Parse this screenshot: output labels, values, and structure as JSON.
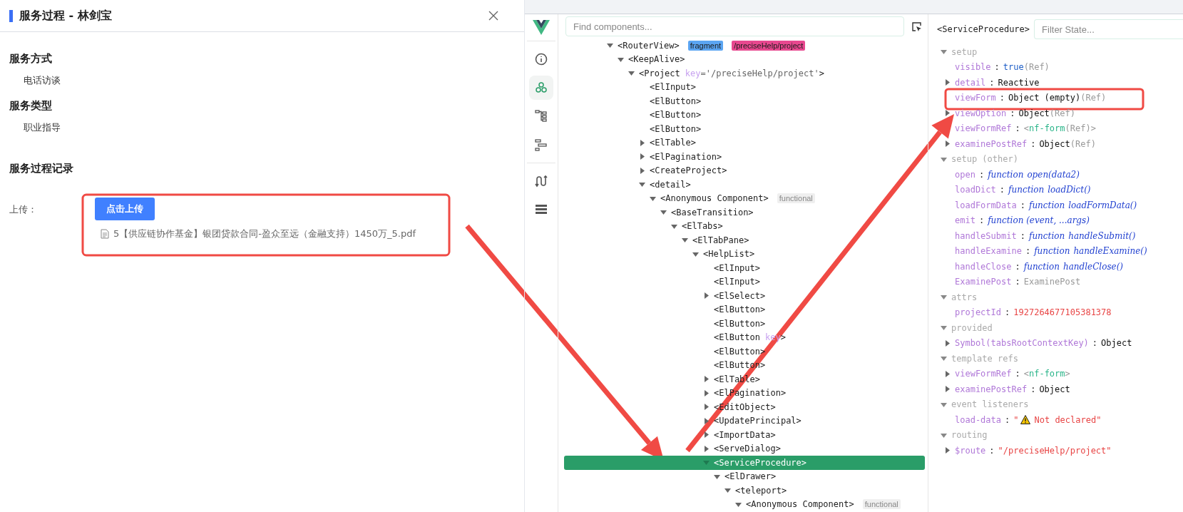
{
  "drawer": {
    "title": "服务过程 - 林剑宝",
    "sections": [
      {
        "heading": "服务方式",
        "value": "电话访谈"
      },
      {
        "heading": "服务类型",
        "value": "职业指导"
      }
    ],
    "record": {
      "heading": "服务过程记录",
      "upload_label": "上传：",
      "upload_button": "点击上传",
      "files": [
        "5【供应链协作基金】银团贷款合同-盈众至远（金融支持）1450万_5.pdf"
      ]
    }
  },
  "devtools": {
    "rail": [
      {
        "kind": "info",
        "selected": false
      },
      {
        "kind": "components",
        "selected": true
      },
      {
        "kind": "tree",
        "selected": false
      },
      {
        "kind": "timeline",
        "selected": false
      },
      {
        "kind": "routes",
        "selected": false
      },
      {
        "kind": "list",
        "selected": false
      }
    ],
    "search": {
      "placeholder": "Find components..."
    },
    "tree": [
      {
        "label": "<RouterView>",
        "expanded": true,
        "selected": false,
        "badges": [
          {
            "text": "fragment",
            "kind": "fragment"
          },
          {
            "text": "/preciseHelp/project",
            "kind": "route"
          }
        ],
        "children": [
          {
            "label": "<KeepAlive>",
            "expanded": true,
            "selected": false,
            "children": [
              {
                "label": "<Project",
                "attr": "key",
                "attr_value": "='/preciseHelp/project'",
                "close": ">",
                "expanded": true,
                "selected": false,
                "children": [
                  {
                    "label": "<ElInput>",
                    "selected": false
                  },
                  {
                    "label": "<ElButton>",
                    "selected": false
                  },
                  {
                    "label": "<ElButton>",
                    "selected": false
                  },
                  {
                    "label": "<ElButton>",
                    "selected": false
                  },
                  {
                    "label": "<ElTable>",
                    "expanded": false,
                    "selected": false
                  },
                  {
                    "label": "<ElPagination>",
                    "expanded": false,
                    "selected": false
                  },
                  {
                    "label": "<CreateProject>",
                    "expanded": false,
                    "selected": false
                  },
                  {
                    "label": "<detail>",
                    "expanded": true,
                    "selected": false,
                    "children": [
                      {
                        "label": "<Anonymous Component>",
                        "expanded": true,
                        "selected": false,
                        "badges": [
                          {
                            "text": "functional",
                            "kind": "functional"
                          }
                        ],
                        "children": [
                          {
                            "label": "<BaseTransition>",
                            "expanded": true,
                            "selected": false,
                            "children": [
                              {
                                "label": "<ElTabs>",
                                "expanded": true,
                                "selected": false,
                                "children": [
                                  {
                                    "label": "<ElTabPane>",
                                    "expanded": true,
                                    "selected": false,
                                    "children": [
                                      {
                                        "label": "<HelpList>",
                                        "expanded": true,
                                        "selected": false,
                                        "children": [
                                          {
                                            "label": "<ElInput>",
                                            "selected": false
                                          },
                                          {
                                            "label": "<ElInput>",
                                            "selected": false
                                          },
                                          {
                                            "label": "<ElSelect>",
                                            "expanded": false,
                                            "selected": false
                                          },
                                          {
                                            "label": "<ElButton>",
                                            "selected": false
                                          },
                                          {
                                            "label": "<ElButton>",
                                            "selected": false
                                          },
                                          {
                                            "label": "<ElButton",
                                            "attr": "key",
                                            "close": ">",
                                            "selected": false
                                          },
                                          {
                                            "label": "<ElButton>",
                                            "selected": false
                                          },
                                          {
                                            "label": "<ElButton>",
                                            "selected": false
                                          },
                                          {
                                            "label": "<ElTable>",
                                            "expanded": false,
                                            "selected": false
                                          },
                                          {
                                            "label": "<ElPagination>",
                                            "expanded": false,
                                            "selected": false
                                          },
                                          {
                                            "label": "<EditObject>",
                                            "expanded": false,
                                            "selected": false
                                          },
                                          {
                                            "label": "<UpdatePrincipal>",
                                            "expanded": false,
                                            "selected": false
                                          },
                                          {
                                            "label": "<ImportData>",
                                            "expanded": false,
                                            "selected": false
                                          },
                                          {
                                            "label": "<ServeDialog>",
                                            "expanded": false,
                                            "selected": false
                                          },
                                          {
                                            "label": "<ServiceProcedure>",
                                            "expanded": true,
                                            "selected": true,
                                            "children": [
                                              {
                                                "label": "<ElDrawer>",
                                                "expanded": true,
                                                "selected": false,
                                                "children": [
                                                  {
                                                    "label": "<teleport>",
                                                    "expanded": true,
                                                    "selected": false,
                                                    "children": [
                                                      {
                                                        "label": "<Anonymous Component>",
                                                        "expanded": true,
                                                        "selected": false,
                                                        "badges": [
                                                          {
                                                            "text": "functional",
                                                            "kind": "functional"
                                                          }
                                                        ]
                                                      }
                                                    ]
                                                  }
                                                ]
                                              }
                                            ]
                                          }
                                        ]
                                      }
                                    ]
                                  }
                                ]
                              }
                            ]
                          }
                        ]
                      }
                    ]
                  }
                ]
              }
            ]
          }
        ]
      }
    ],
    "inspector": {
      "component": "<ServiceProcedure>",
      "filter_placeholder": "Filter State...",
      "sections": [
        {
          "title": "setup",
          "expanded": true,
          "rows": [
            {
              "key": "visible",
              "value": [
                {
                  "text": ":",
                  "kind": "sep"
                },
                {
                  "text": "true",
                  "kind": "keyword"
                },
                {
                  "text": "(Ref)",
                  "kind": "note"
                }
              ]
            },
            {
              "key": "detail",
              "expanded": false,
              "value": [
                {
                  "text": ":",
                  "kind": "sep"
                },
                {
                  "text": "Reactive",
                  "kind": "plain"
                }
              ]
            },
            {
              "key": "viewForm",
              "value": [
                {
                  "text": ":",
                  "kind": "sep"
                },
                {
                  "text": "Object (empty)",
                  "kind": "plain"
                },
                {
                  "text": "(Ref)",
                  "kind": "note"
                }
              ]
            },
            {
              "key": "viewOption",
              "expanded": false,
              "value": [
                {
                  "text": ":",
                  "kind": "sep"
                },
                {
                  "text": "Object",
                  "kind": "plain"
                },
                {
                  "text": "(Ref)",
                  "kind": "note"
                }
              ]
            },
            {
              "key": "viewFormRef",
              "value": [
                {
                  "text": ":",
                  "kind": "sep"
                },
                {
                  "text": "<",
                  "kind": "note"
                },
                {
                  "text": "nf-form",
                  "kind": "tag"
                },
                {
                  "text": "(Ref)>",
                  "kind": "note"
                }
              ]
            },
            {
              "key": "examinePostRef",
              "expanded": false,
              "value": [
                {
                  "text": ":",
                  "kind": "sep"
                },
                {
                  "text": "Object",
                  "kind": "plain"
                },
                {
                  "text": "(Ref)",
                  "kind": "note"
                }
              ]
            }
          ]
        },
        {
          "title": "setup (other)",
          "expanded": true,
          "rows": [
            {
              "key": "open",
              "value": [
                {
                  "text": ":",
                  "kind": "sep"
                },
                {
                  "text": "function",
                  "kind": "fn"
                },
                {
                  "text": "open(data2)",
                  "kind": "fnname"
                }
              ]
            },
            {
              "key": "loadDict",
              "value": [
                {
                  "text": ":",
                  "kind": "sep"
                },
                {
                  "text": "function",
                  "kind": "fn"
                },
                {
                  "text": "loadDict()",
                  "kind": "fnname"
                }
              ]
            },
            {
              "key": "loadFormData",
              "value": [
                {
                  "text": ":",
                  "kind": "sep"
                },
                {
                  "text": "function",
                  "kind": "fn"
                },
                {
                  "text": "loadFormData()",
                  "kind": "fnname"
                }
              ]
            },
            {
              "key": "emit",
              "value": [
                {
                  "text": ":",
                  "kind": "sep"
                },
                {
                  "text": "function (event, ...args)",
                  "kind": "fn"
                }
              ]
            },
            {
              "key": "handleSubmit",
              "value": [
                {
                  "text": ":",
                  "kind": "sep"
                },
                {
                  "text": "function",
                  "kind": "fn"
                },
                {
                  "text": "handleSubmit()",
                  "kind": "fnname"
                }
              ]
            },
            {
              "key": "handleExamine",
              "value": [
                {
                  "text": ":",
                  "kind": "sep"
                },
                {
                  "text": "function",
                  "kind": "fn"
                },
                {
                  "text": "handleExamine()",
                  "kind": "fnname"
                }
              ]
            },
            {
              "key": "handleClose",
              "value": [
                {
                  "text": ":",
                  "kind": "sep"
                },
                {
                  "text": "function",
                  "kind": "fn"
                },
                {
                  "text": "handleClose()",
                  "kind": "fnname"
                }
              ]
            },
            {
              "key": "ExaminePost",
              "value": [
                {
                  "text": ":",
                  "kind": "sep"
                },
                {
                  "text": "ExaminePost",
                  "kind": "note"
                }
              ]
            }
          ]
        },
        {
          "title": "attrs",
          "expanded": true,
          "rows": [
            {
              "key": "projectId",
              "value": [
                {
                  "text": ":",
                  "kind": "sep"
                },
                {
                  "text": "1927264677105381378",
                  "kind": "string"
                }
              ]
            }
          ]
        },
        {
          "title": "provided",
          "expanded": true,
          "rows": [
            {
              "key": "Symbol(tabsRootContextKey)",
              "expanded": false,
              "value": [
                {
                  "text": ":",
                  "kind": "sep"
                },
                {
                  "text": "Object",
                  "kind": "plain"
                }
              ]
            }
          ]
        },
        {
          "title": "template refs",
          "expanded": true,
          "rows": [
            {
              "key": "viewFormRef",
              "expanded": false,
              "value": [
                {
                  "text": ":",
                  "kind": "sep"
                },
                {
                  "text": "<",
                  "kind": "note"
                },
                {
                  "text": "nf-form",
                  "kind": "tag"
                },
                {
                  "text": ">",
                  "kind": "note"
                }
              ]
            },
            {
              "key": "examinePostRef",
              "expanded": false,
              "value": [
                {
                  "text": ":",
                  "kind": "sep"
                },
                {
                  "text": "Object",
                  "kind": "plain"
                }
              ]
            }
          ]
        },
        {
          "title": "event listeners",
          "expanded": true,
          "rows": [
            {
              "key": "load-data",
              "value": [
                {
                  "text": ":",
                  "kind": "sep"
                },
                {
                  "text": "\"",
                  "kind": "string"
                },
                {
                  "kind": "warning"
                },
                {
                  "text": "Not declared\"",
                  "kind": "string"
                }
              ]
            }
          ]
        },
        {
          "title": "routing",
          "expanded": true,
          "rows": [
            {
              "key": "$route",
              "expanded": false,
              "value": [
                {
                  "text": ":",
                  "kind": "sep"
                },
                {
                  "text": "\"/preciseHelp/project\"",
                  "kind": "string"
                }
              ]
            }
          ]
        }
      ]
    }
  }
}
